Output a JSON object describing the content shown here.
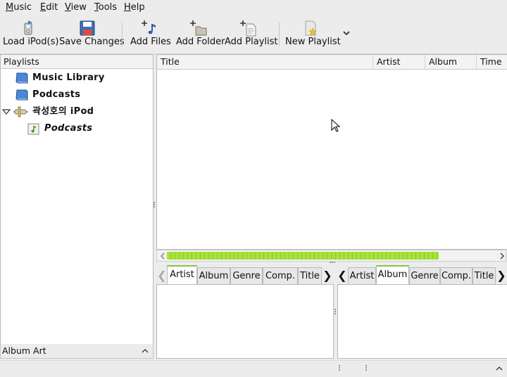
{
  "menubar": {
    "items": [
      {
        "label": "Music",
        "mnemonic": "M"
      },
      {
        "label": "Edit",
        "mnemonic": "E"
      },
      {
        "label": "View",
        "mnemonic": "V"
      },
      {
        "label": "Tools",
        "mnemonic": "T"
      },
      {
        "label": "Help",
        "mnemonic": "H"
      }
    ]
  },
  "toolbar": {
    "load_ipods": "Load iPod(s)",
    "save_changes": "Save Changes",
    "add_files": "Add Files",
    "add_folder": "Add Folder",
    "add_playlist": "Add Playlist",
    "new_playlist": "New Playlist"
  },
  "playlists": {
    "header": "Playlists",
    "items": [
      {
        "label": "Music Library",
        "icon": "book-icon"
      },
      {
        "label": "Podcasts",
        "icon": "book-icon"
      },
      {
        "label": "곽성호의 iPod",
        "icon": "ipod-icon",
        "expanded": true
      },
      {
        "label": "Podcasts",
        "icon": "podcast-playlist-icon",
        "italic": true
      }
    ]
  },
  "tracks": {
    "columns": [
      "Title",
      "Artist",
      "Album",
      "Time"
    ]
  },
  "filters": {
    "left": {
      "tabs": [
        "Artist",
        "Album",
        "Genre",
        "Comp.",
        "Title"
      ],
      "active": "Artist"
    },
    "right": {
      "tabs": [
        "Artist",
        "Album",
        "Genre",
        "Comp.",
        "Title"
      ],
      "active": "Album"
    }
  },
  "album_art": {
    "label": "Album Art"
  },
  "colors": {
    "accent": "#8bc33d",
    "progress": "#a6e23a"
  }
}
